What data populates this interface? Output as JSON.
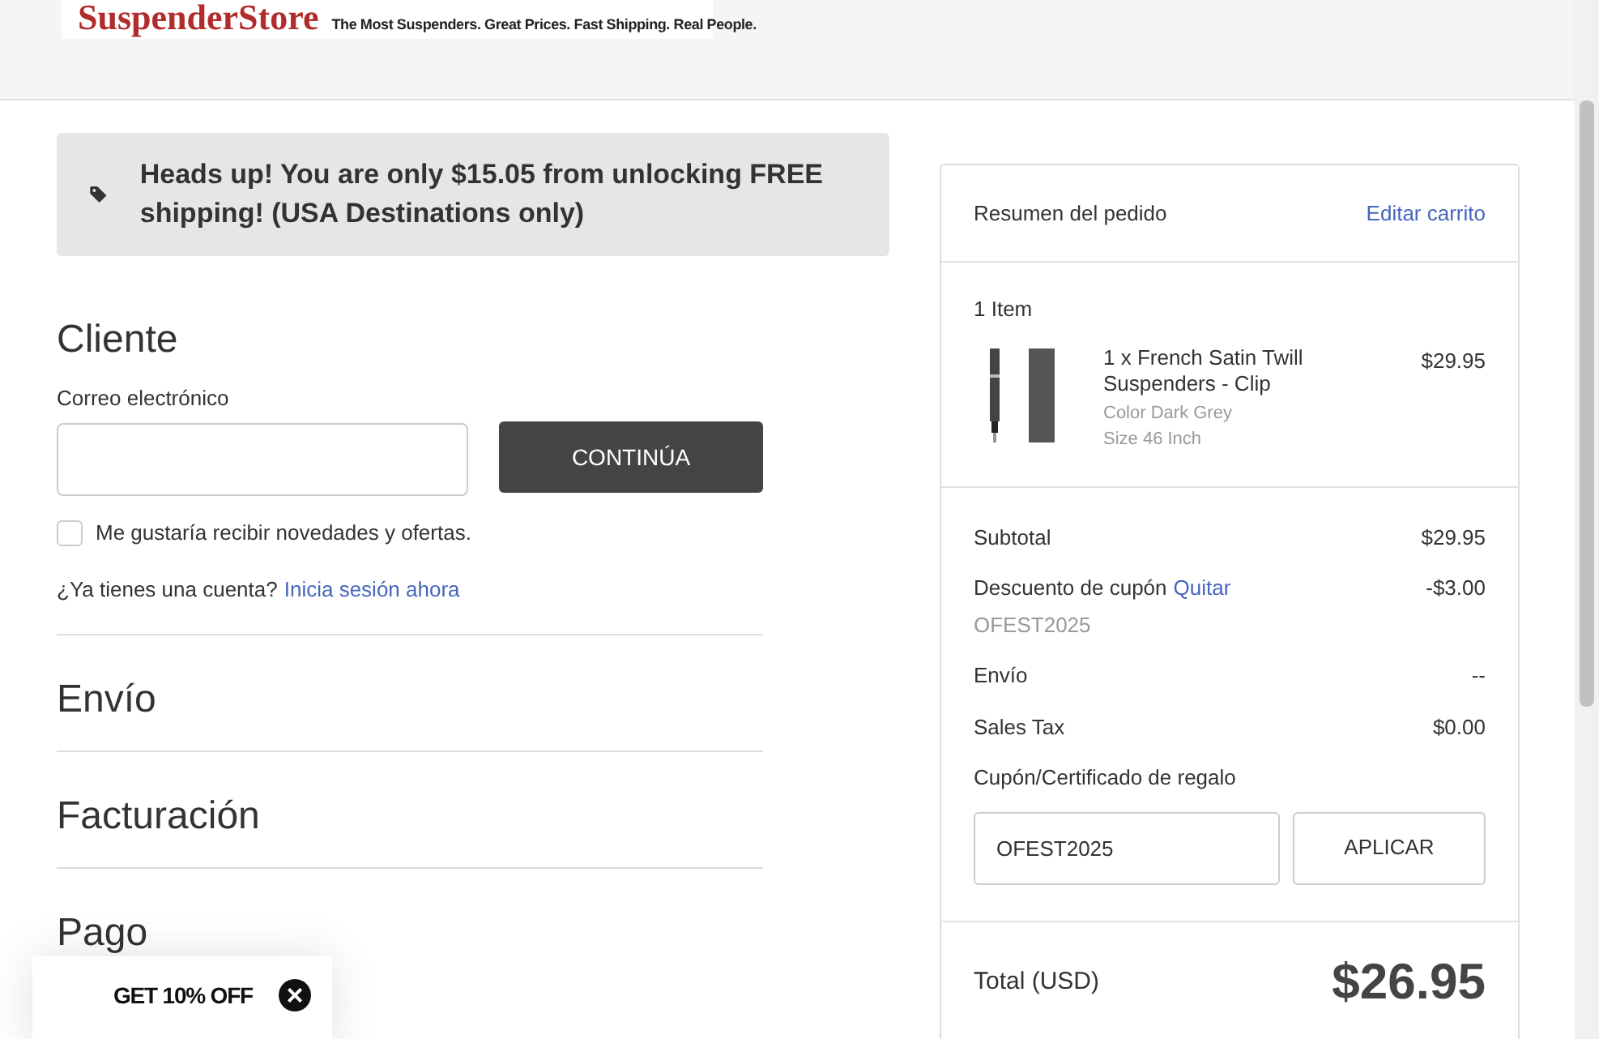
{
  "header": {
    "logo_text": "SuspenderStore",
    "tagline": "The Most Suspenders. Great Prices. Fast Shipping. Real People."
  },
  "notice": {
    "text": "Heads up! You are only $15.05 from unlocking FREE shipping! (USA Destinations only)"
  },
  "customer": {
    "heading": "Cliente",
    "email_label": "Correo electrónico",
    "continue_button": "CONTINÚA",
    "newsletter": {
      "label": "Me gustaría recibir novedades y ofertas.",
      "checked": false
    },
    "account_prompt": "¿Ya tienes una cuenta?",
    "sign_in_link": "Inicia sesión ahora"
  },
  "sections": [
    {
      "heading": "Envío"
    },
    {
      "heading": "Facturación"
    },
    {
      "heading": "Pago"
    }
  ],
  "summary": {
    "title": "Resumen del pedido",
    "edit_link": "Editar carrito",
    "item_count": "1 Item",
    "items": [
      {
        "title": "1 x French Satin Twill Suspenders - Clip",
        "color_option": "Color Dark Grey",
        "size": "Size 46 Inch",
        "price": "$29.95"
      }
    ],
    "lines": [
      {
        "label": "Subtotal",
        "value": "$29.95"
      },
      {
        "label": "Descuento de cupón",
        "link": "Quitar",
        "code": "OFEST2025",
        "value": "-$3.00"
      },
      {
        "label": "Envío",
        "value": "--"
      },
      {
        "label": "Sales Tax",
        "value": "$0.00"
      }
    ],
    "coupon_label": "Cupón/Certificado de regalo",
    "coupon_value": "OFEST2025",
    "apply_button": "APLICAR",
    "total_label": "Total (USD)",
    "total_value": "$26.95"
  },
  "promo": {
    "text": "GET 10% OFF",
    "close": "×"
  }
}
